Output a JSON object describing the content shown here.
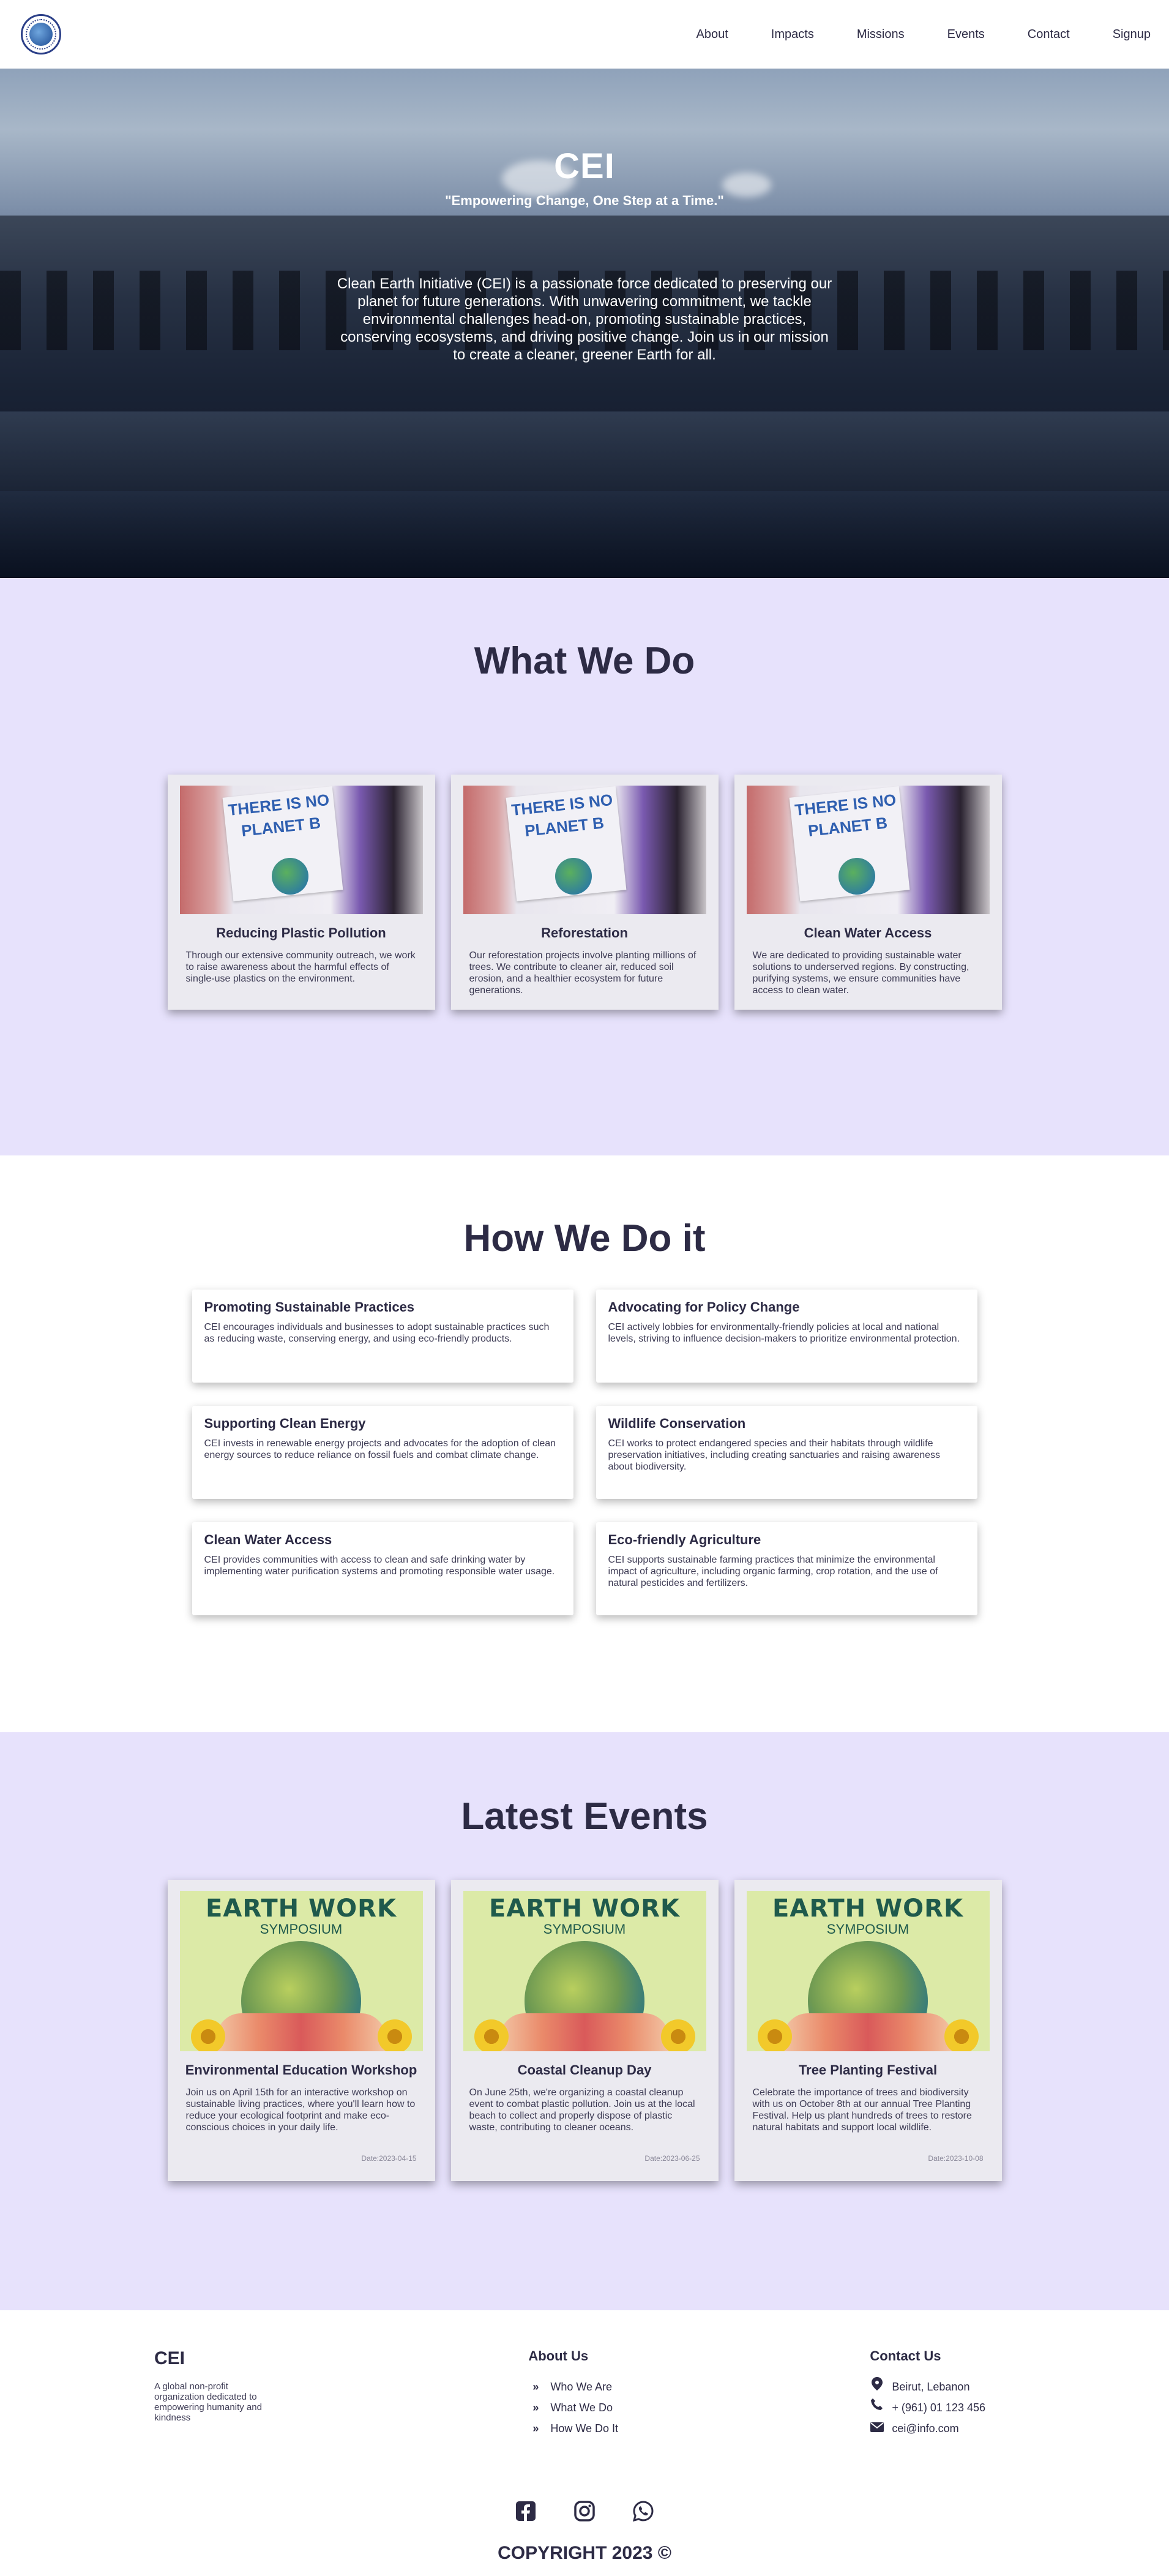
{
  "nav": {
    "logo_icon": "cei-globe-logo",
    "links": [
      "About",
      "Impacts",
      "Missions",
      "Events",
      "Contact",
      "Signup"
    ]
  },
  "hero": {
    "title": "CEI",
    "tagline": "\"Empowering Change, One Step at a Time.\"",
    "description": "Clean Earth Initiative (CEI) is a passionate force dedicated to preserving our planet for future generations. With unwavering commitment, we tackle environmental challenges head-on, promoting sustainable practices, conserving ecosystems, and driving positive change. Join us in our mission to create a cleaner, greener Earth for all."
  },
  "what_we_do": {
    "title": "What We Do",
    "image_text": [
      "THERE IS NO",
      "PLANET B"
    ],
    "cards": [
      {
        "title": "Reducing Plastic Pollution",
        "text": "Through our extensive community outreach, we work to raise awareness about the harmful effects of single-use plastics on the environment."
      },
      {
        "title": "Reforestation",
        "text": "Our reforestation projects involve planting millions of trees. We contribute to cleaner air, reduced soil erosion, and a healthier ecosystem for future generations."
      },
      {
        "title": "Clean Water Access",
        "text": "We are dedicated to providing sustainable water solutions to underserved regions. By constructing, purifying systems, we ensure communities have access to clean water."
      }
    ]
  },
  "how_we_do_it": {
    "title": "How We Do it",
    "items": [
      {
        "title": "Promoting Sustainable Practices",
        "text": "CEI encourages individuals and businesses to adopt sustainable practices such as reducing waste, conserving energy, and using eco-friendly products."
      },
      {
        "title": "Advocating for Policy Change",
        "text": "CEI actively lobbies for environmentally-friendly policies at local and national levels, striving to influence decision-makers to prioritize environmental protection."
      },
      {
        "title": "Supporting Clean Energy",
        "text": "CEI invests in renewable energy projects and advocates for the adoption of clean energy sources to reduce reliance on fossil fuels and combat climate change."
      },
      {
        "title": "Wildlife Conservation",
        "text": "CEI works to protect endangered species and their habitats through wildlife preservation initiatives, including creating sanctuaries and raising awareness about biodiversity."
      },
      {
        "title": "Clean Water Access",
        "text": "CEI provides communities with access to clean and safe drinking water by implementing water purification systems and promoting responsible water usage."
      },
      {
        "title": "Eco-friendly Agriculture",
        "text": "CEI supports sustainable farming practices that minimize the environmental impact of agriculture, including organic farming, crop rotation, and the use of natural pesticides and fertilizers."
      }
    ]
  },
  "events": {
    "title": "Latest Events",
    "poster_title": "EARTH WORK",
    "poster_subtitle": "SYMPOSIUM",
    "cards": [
      {
        "title": "Environmental Education Workshop",
        "text": "Join us on April 15th for an interactive workshop on sustainable living practices, where you'll learn how to reduce your ecological footprint and make eco-conscious choices in your daily life.",
        "date": "Date:2023-04-15"
      },
      {
        "title": "Coastal Cleanup Day",
        "text": "On June 25th, we're organizing a coastal cleanup event to combat plastic pollution. Join us at the local beach to collect and properly dispose of plastic waste, contributing to cleaner oceans.",
        "date": "Date:2023-06-25"
      },
      {
        "title": "Tree Planting Festival",
        "text": "Celebrate the importance of trees and biodiversity with us on October 8th at our annual Tree Planting Festival. Help us plant hundreds of trees to restore natural habitats and support local wildlife.",
        "date": "Date:2023-10-08"
      }
    ]
  },
  "footer": {
    "brand": {
      "title": "CEI",
      "text": "A global non-profit organization dedicated to empowering humanity and kindness"
    },
    "about": {
      "title": "About Us",
      "links": [
        "Who We Are",
        "What We Do",
        "How We Do It"
      ]
    },
    "contact": {
      "title": "Contact Us",
      "location": "Beirut, Lebanon",
      "phone": "+ (961) 01 123 456",
      "email": "cei@info.com"
    },
    "social_icons": [
      "facebook-icon",
      "instagram-icon",
      "whatsapp-icon"
    ],
    "copyright": "COPYRIGHT 2023 ©"
  }
}
